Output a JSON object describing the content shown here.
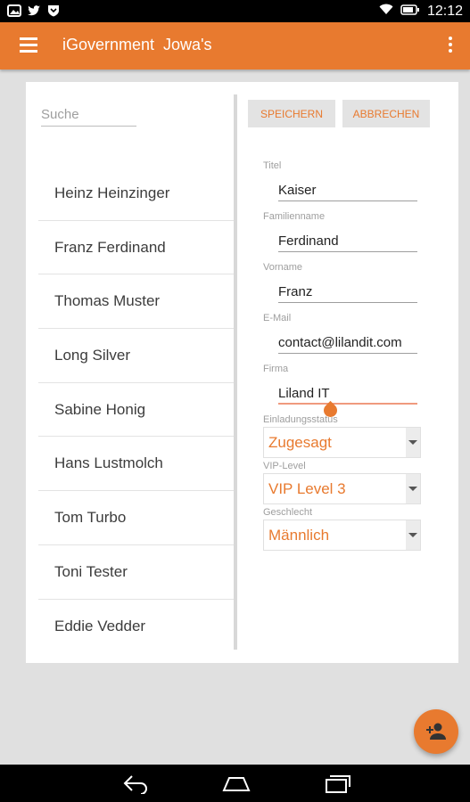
{
  "status_bar": {
    "time": "12:12"
  },
  "app_bar": {
    "title": "iGovernment  Jowa's"
  },
  "search": {
    "placeholder": "Suche"
  },
  "people": [
    "Heinz Heinzinger",
    "Franz Ferdinand",
    "Thomas Muster",
    "Long Silver",
    "Sabine Honig",
    "Hans Lustmolch",
    "Tom Turbo",
    "Toni Tester",
    "Eddie Vedder"
  ],
  "actions": {
    "save": "SPEICHERN",
    "cancel": "ABBRECHEN"
  },
  "form": {
    "title": {
      "label": "Titel",
      "value": "Kaiser"
    },
    "lastname": {
      "label": "Familienname",
      "value": "Ferdinand"
    },
    "firstname": {
      "label": "Vorname",
      "value": "Franz"
    },
    "email": {
      "label": "E-Mail",
      "value": "contact@lilandit.com"
    },
    "company": {
      "label": "Firma",
      "value": "Liland IT"
    },
    "invitation": {
      "label": "Einladungsstatus",
      "value": "Zugesagt"
    },
    "vip": {
      "label": "VIP-Level",
      "value": "VIP Level 3"
    },
    "gender": {
      "label": "Geschlecht",
      "value": "Männlich"
    }
  },
  "colors": {
    "accent": "#e87a2f",
    "background": "#e0e0e0"
  },
  "icons": {
    "fab": "add-person-icon",
    "menu": "menu-icon",
    "overflow": "overflow-icon"
  }
}
